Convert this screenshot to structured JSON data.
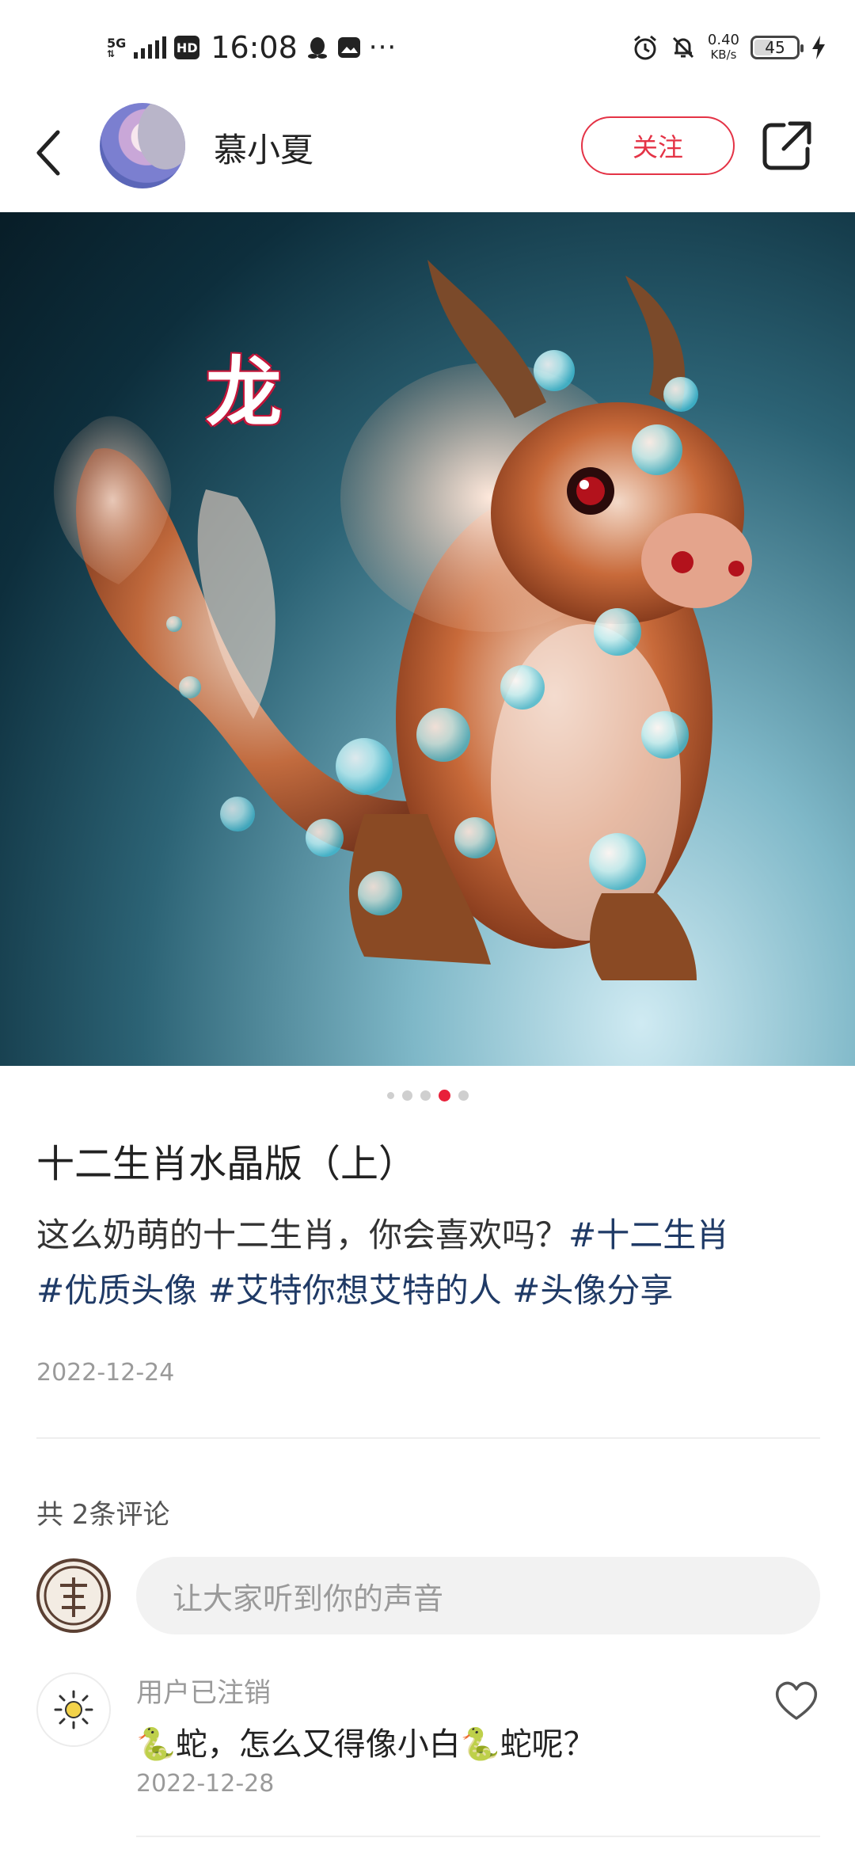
{
  "status_bar": {
    "network": "5G",
    "hd": "HD",
    "time": "16:08",
    "more": "···",
    "speed_value": "0.40",
    "speed_unit": "KB/s",
    "battery": "45",
    "battery_level_percent": 45
  },
  "header": {
    "username": "慕小夏",
    "follow_label": "关注"
  },
  "photo": {
    "overlay_text": "龙",
    "page_count": 5,
    "active_page": 4
  },
  "post": {
    "title": "十二生肖水晶版（上）",
    "description": "这么奶萌的十二生肖，你会喜欢吗？",
    "tags": [
      "#十二生肖",
      "#优质头像",
      "#艾特你想艾特的人",
      "#头像分享"
    ],
    "date": "2022-12-24"
  },
  "comments": {
    "count_label": "共 2条评论",
    "input_placeholder": "让大家听到你的声音",
    "items": [
      {
        "user": "用户已注销",
        "text": "🐍蛇，怎么又得像小白🐍蛇呢？",
        "date": "2022-12-28"
      }
    ]
  },
  "icons": {
    "back": "chevron-left-icon",
    "share": "share-external-icon",
    "like": "heart-outline-icon",
    "alarm": "alarm-icon",
    "mute": "bell-off-icon",
    "charging": "bolt-icon"
  },
  "colors": {
    "accent": "#e43346",
    "tag": "#1f3a66",
    "active_dot": "#e8203a"
  }
}
